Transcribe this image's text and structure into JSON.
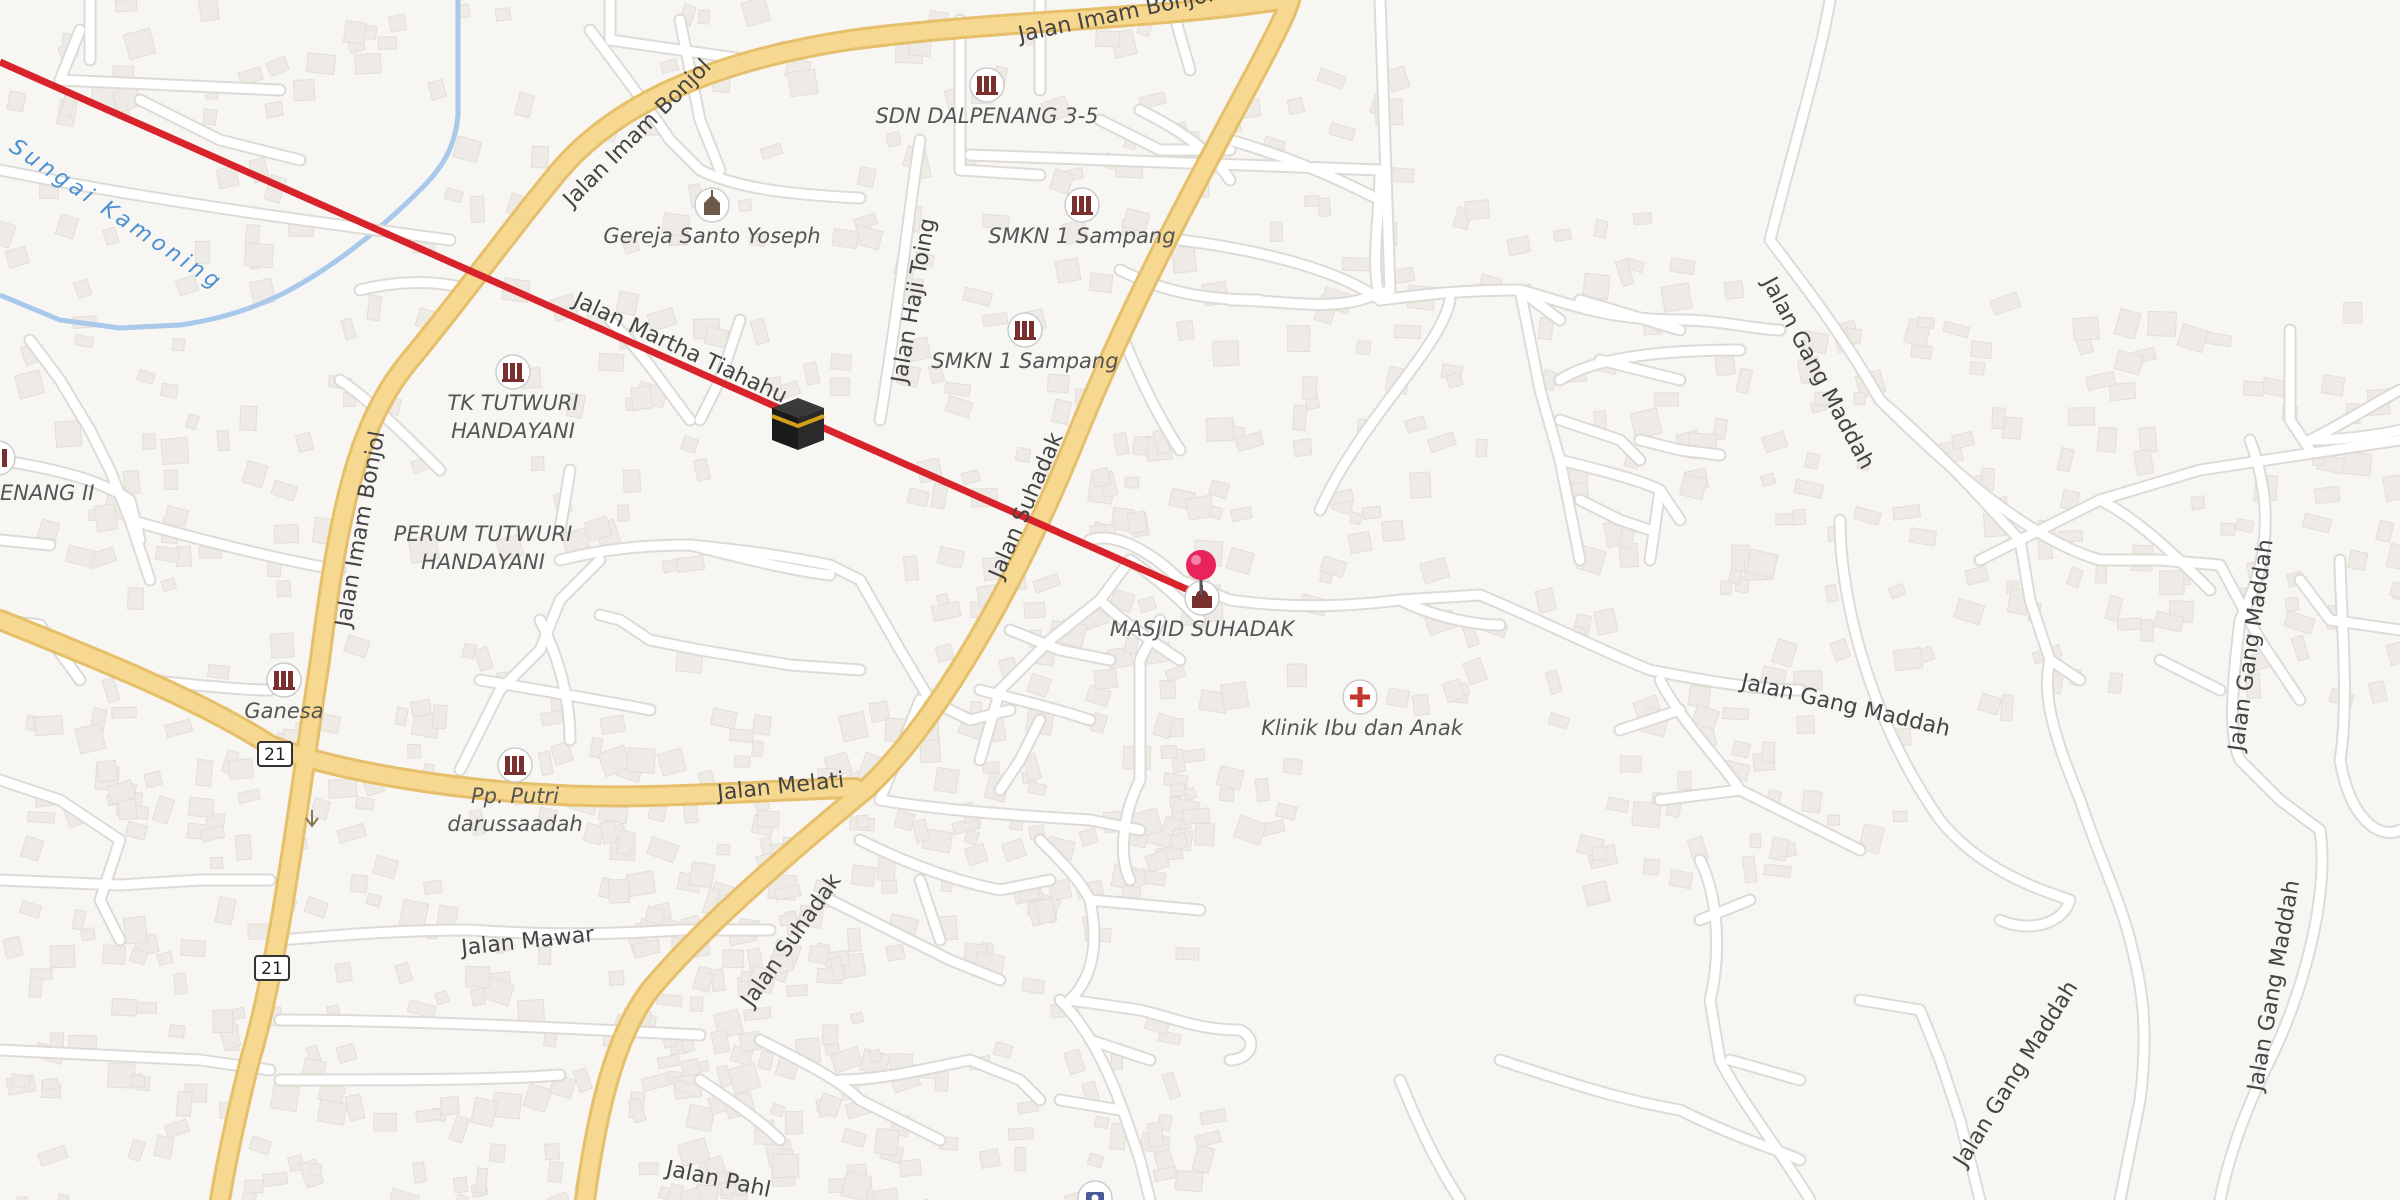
{
  "map": {
    "roads": {
      "imam_bonjol_top": "Jalan Imam Bonjol",
      "imam_bonjol_diag": "Jalan Imam Bonjol",
      "imam_bonjol_vert": "Jalan Imam Bonjol",
      "martha": "Jalan Martha Tiahahu",
      "haji_toing": "Jalan Haji Toing",
      "suhadak_upper": "Jalan Suhadak",
      "suhadak_lower": "Jalan Suhadak",
      "melati": "Jalan Melati",
      "mawar": "Jalan Mawar",
      "pahlawan": "Jalan Pahl",
      "gang_maddah_1": "Jalan Gang Maddah",
      "gang_maddah_2": "Jalan Gang Maddah",
      "gang_maddah_3": "Jalan Gang Maddah",
      "gang_maddah_4": "Jalan Gang Maddah",
      "gang_maddah_5": "Jalan Gang Maddah"
    },
    "waterway": "Sungai Kamoning",
    "shields": [
      "21",
      "21"
    ],
    "pois": {
      "sdn": "SDN DALPENANG 3-5",
      "gereja": "Gereja Santo Yoseph",
      "smkn_a": "SMKN 1 Sampang",
      "smkn_b": "SMKN 1 Sampang",
      "tk_1": "TK TUTWURI",
      "tk_2": "HANDAYANI",
      "perum_1": "PERUM TUTWURI",
      "perum_2": "HANDAYANI",
      "enang": "ENANG II",
      "masjid": "MASJID SUHADAK",
      "klinik": "Klinik Ibu dan Anak",
      "ganesa": "Ganesa",
      "pp_1": "Pp. Putri",
      "pp_2": "darussaadah"
    },
    "icons": {
      "school": "school-icon",
      "church": "church-icon",
      "mosque": "mosque-icon",
      "clinic": "clinic-icon",
      "kaaba": "kaaba-icon",
      "pin": "location-pin-icon",
      "camera": "camera-icon"
    },
    "colors": {
      "background": "#f8f6f3",
      "major_road": "#f6d890",
      "major_road_casing": "#e6bf6a",
      "minor_road": "#ffffff",
      "minor_road_casing": "#dedbd6",
      "building": "#eeebe6",
      "water": "#a8c8ec",
      "qibla_line": "#d8232a",
      "pin": "#e8245a"
    }
  }
}
